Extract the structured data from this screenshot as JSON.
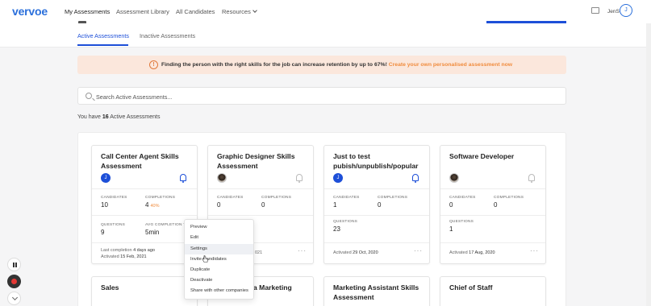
{
  "app": {
    "logo": "vervoe",
    "nav": [
      "My Assessments",
      "Assessment Library",
      "All Candidates",
      "Resources"
    ],
    "user": {
      "name": "JenS",
      "initial": "J"
    }
  },
  "tabs": [
    "Active Assessments",
    "Inactive Assessments"
  ],
  "banner": {
    "text": "Finding the person with the right skills for the job can increase retention by up to 67%!",
    "link": "Create your own personalised assessment now"
  },
  "search": {
    "placeholder": "Search Active Assessments...",
    "value": ""
  },
  "count": {
    "prefix": "You have",
    "number": "16",
    "suffix": "Active Assessments"
  },
  "labels": {
    "candidates": "CANDIDATES",
    "completions": "COMPLETIONS",
    "questions": "QUESTIONS",
    "avg_completion": "AVG COMPLETION TIME"
  },
  "cards": [
    {
      "title": "Call Center Agent Skills Assessment",
      "avatar": "J",
      "candidates": "10",
      "completions": "4",
      "completion_pct": "40%",
      "questions": "9",
      "avg_time": "5min",
      "last_completion_label": "Last completion",
      "last_completion": "4 days ago",
      "activated_label": "Activated",
      "activated": "15 Feb, 2021"
    },
    {
      "title": "Graphic Designer Skills Assessment",
      "candidates": "0",
      "completions": "0",
      "activated_label": "Activated",
      "activated_partial": "021"
    },
    {
      "title": "Just to test pubish/unpublish/popular",
      "avatar": "J",
      "candidates": "1",
      "completions": "0",
      "questions": "23",
      "activated_label": "Activated",
      "activated": "29 Oct, 2020"
    },
    {
      "title": "Software Developer",
      "candidates": "0",
      "completions": "0",
      "questions": "1",
      "activated_label": "Activated",
      "activated": "17 Aug, 2020"
    },
    {
      "title": "Sales"
    },
    {
      "title_partial": "a Marketing"
    },
    {
      "title": "Marketing Assistant Skills Assessment"
    },
    {
      "title": "Chief of Staff"
    }
  ],
  "menu": [
    "Preview",
    "Edit",
    "Settings",
    "Invite Candidates",
    "Duplicate",
    "Deactivate",
    "Share with other companies"
  ],
  "colors": {
    "brand": "#1d4fd8",
    "accent": "#f08c3e",
    "banner_bg": "#fbe7dc"
  },
  "icons": [
    "pause-icon",
    "record-stop-icon",
    "chevron-down-icon",
    "bell-icon",
    "message-icon",
    "search-icon",
    "warning-icon",
    "more-icon"
  ]
}
